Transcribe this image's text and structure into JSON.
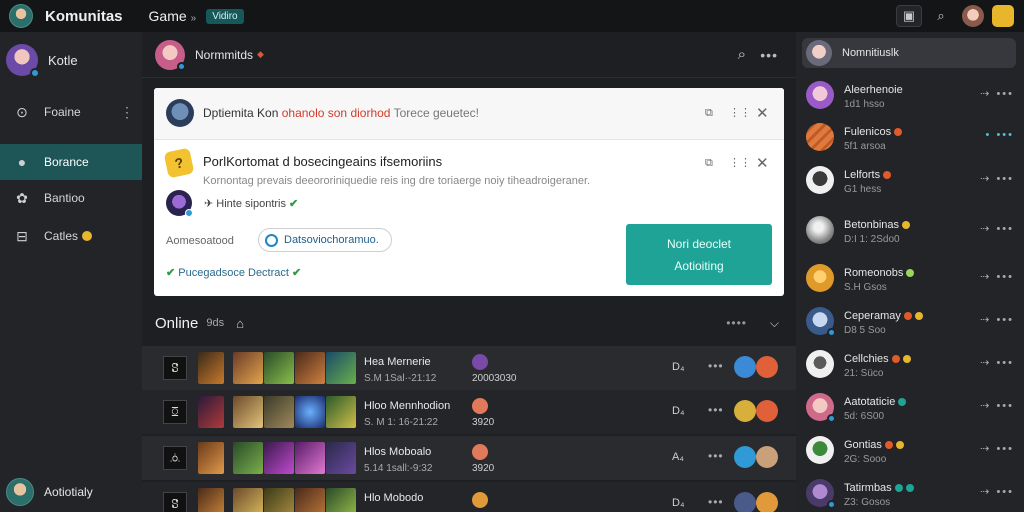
{
  "topbar": {
    "app_title": "Komunitas",
    "game_tab": "Game",
    "game_tab_icon": "»",
    "badge": "Vidiro"
  },
  "sidebar": {
    "user_name": "Kotle",
    "items": [
      {
        "label": "Foaine",
        "icon": "gamepad-icon"
      },
      {
        "label": "Borance",
        "icon": "person-icon",
        "active": true
      },
      {
        "label": "Bantioo",
        "icon": "controller-icon"
      },
      {
        "label": "Catles",
        "icon": "case-icon"
      }
    ],
    "bottom_user": "Aotiotialy"
  },
  "main": {
    "header_title": "Normmitds",
    "notification": {
      "row1_text_a": "Dptiemita Kon",
      "row1_text_red": "ohanolo son diorhod",
      "row1_text_gray": "Torece geuetec!",
      "title": "PorlKortomat d bosecingeains ifsemoriins",
      "desc": "Kornontag prevais deeororiniquedie reis ing dre toriaerge noiy tiheadroigeraner.",
      "status": "Hinte sipontris",
      "assoc_label": "Aomesoatood",
      "assoc_button": "Datsoviochoramuo.",
      "confirm": "Pucegadsoce Dectract",
      "cta_line1": "Nori deoclet",
      "cta_line2": "Aotioiting"
    },
    "online": {
      "title": "Online",
      "count": "9ds",
      "rows": [
        {
          "icon_char": "ꗟ",
          "name": "Hea Mernerie",
          "sub": "S.M 1Sal·-21:12",
          "score": "20003030",
          "ch": "D₄"
        },
        {
          "icon_char": "ꗞ",
          "name": "Hloo Mennhodion",
          "sub": "S. M 1: 16-21:22",
          "score": "3920",
          "ch": "D₄"
        },
        {
          "icon_char": "ꗝ",
          "name": "Hlos Moboalo",
          "sub": "5.14 1sall:-9:32",
          "score": "3920",
          "ch": "A₄"
        },
        {
          "icon_char": "ꗟ",
          "name": "Hlo Mobodo",
          "sub": "",
          "score": "",
          "ch": "D₄"
        }
      ]
    }
  },
  "friends": {
    "search_label": "Nomnitiuslk",
    "items": [
      {
        "name": "Aleerhenoie",
        "sub": "1d1 hsso",
        "badge_color": ""
      },
      {
        "name": "Fulenicos",
        "sub": "5f1 arsoa",
        "badge_color": "#e05a2a"
      },
      {
        "name": "Lelforts",
        "sub": "G1 hess",
        "badge_color": "#e05a2a"
      },
      {
        "name": "Betonbinas",
        "sub": "D:I 1: 2Sdo0",
        "badge_color": "#e7b62a"
      },
      {
        "name": "Romeonobs",
        "sub": "S.H Gsos",
        "badge_color": "#9ad65a"
      },
      {
        "name": "Ceperamay",
        "sub": "D8 5 Soo",
        "badge_color": "#e05a2a"
      },
      {
        "name": "Cellchies",
        "sub": "21: Süco",
        "badge_color": "#e7b62a"
      },
      {
        "name": "Aatotaticie",
        "sub": "5d: 6S00",
        "badge_color": "#1fa396"
      },
      {
        "name": "Gontias",
        "sub": "2G: Sooo",
        "badge_color": "#e05a2a"
      },
      {
        "name": "Tatirmbas",
        "sub": "Z3: Gosos",
        "badge_color": "#1fa396"
      }
    ]
  }
}
